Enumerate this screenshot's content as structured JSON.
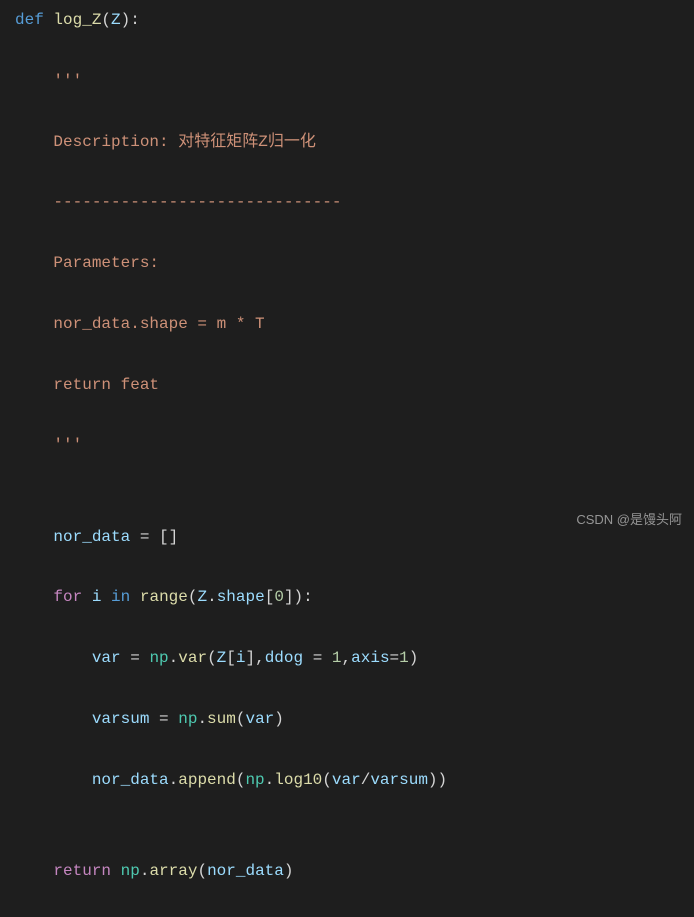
{
  "code": {
    "l1": {
      "def": "def ",
      "fn": "log_Z",
      "open": "(",
      "param": "Z",
      "close": "):"
    },
    "l2": "    '''",
    "l3": "    Description: 对特征矩阵Z归一化",
    "l4": "    ------------------------------",
    "l5": "    Parameters:",
    "l6": "    nor_data.shape = m * T",
    "l7": "    return feat",
    "l8": "    '''",
    "l9": "",
    "l10": {
      "indent": "    ",
      "var": "nor_data",
      "eq": " = []"
    },
    "l11": {
      "indent": "    ",
      "for": "for",
      "sp1": " ",
      "i": "i",
      "sp2": " ",
      "in": "in",
      "sp3": " ",
      "range": "range",
      "op": "(",
      "z": "Z",
      "dot": ".",
      "shape": "shape",
      "br": "[",
      "zero": "0",
      "cbr": "]):"
    },
    "l12": {
      "indent": "        ",
      "var": "var",
      "eq": " = ",
      "np": "np",
      "dot1": ".",
      "fn": "var",
      "op": "(",
      "z": "Z",
      "br": "[",
      "i": "i",
      "cbr": "],",
      "ddog": "ddog",
      "eq2": " = ",
      "one": "1",
      "comma": ",",
      "axis": "axis",
      "eq3": "=",
      "one2": "1",
      "cl": ")"
    },
    "l13": {
      "indent": "        ",
      "var": "varsum",
      "eq": " = ",
      "np": "np",
      "dot": ".",
      "fn": "sum",
      "op": "(",
      "arg": "var",
      "cl": ")"
    },
    "l14": {
      "indent": "        ",
      "var": "nor_data",
      "dot": ".",
      "append": "append",
      "op": "(",
      "np": "np",
      "dot2": ".",
      "log": "log10",
      "op2": "(",
      "v1": "var",
      "slash": "/",
      "v2": "varsum",
      "cl": "))"
    },
    "l15": "",
    "l16": {
      "indent": "    ",
      "ret": "return",
      "sp": " ",
      "np": "np",
      "dot": ".",
      "fn": "array",
      "op": "(",
      "arg": "nor_data",
      "cl": ")"
    }
  },
  "watermark": "CSDN @是馒头阿"
}
